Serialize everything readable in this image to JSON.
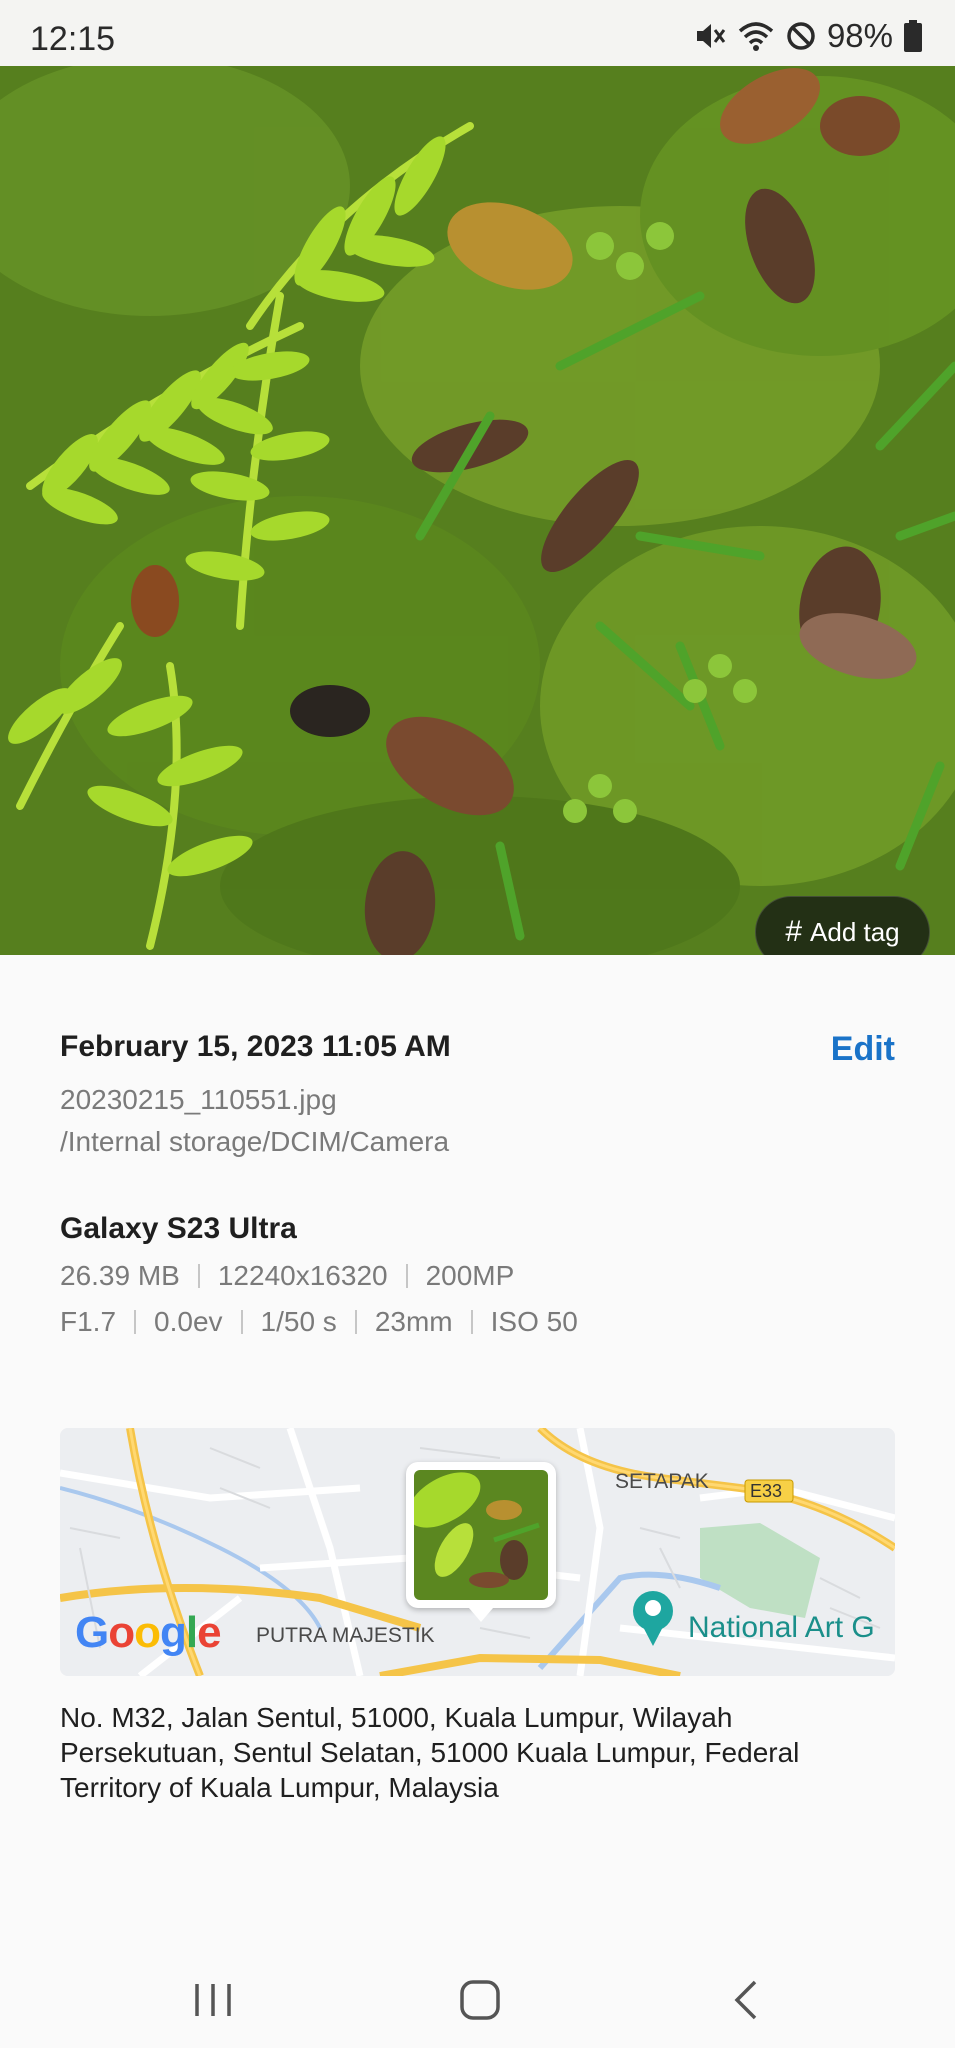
{
  "status_bar": {
    "time": "12:15",
    "battery": "98%",
    "icons": [
      "mute-icon",
      "wifi-icon",
      "do-not-disturb-icon",
      "battery-icon"
    ]
  },
  "photo": {
    "add_tag_label": "Add tag"
  },
  "details": {
    "datetime": "February 15, 2023 11:05 AM",
    "edit_label": "Edit",
    "filename": "20230215_110551.jpg",
    "path": "/Internal storage/DCIM/Camera",
    "device": "Galaxy S23 Ultra",
    "file_specs": [
      "26.39 MB",
      "12240x16320",
      "200MP"
    ],
    "camera_specs": [
      "F1.7",
      "0.0ev",
      "1/50 s",
      "23mm",
      "ISO 50"
    ]
  },
  "map": {
    "labels": {
      "setapak": "SETAPAK",
      "e33": "E33",
      "putra_majestik": "PUTRA MAJESTIK",
      "national_art": "National Art G"
    },
    "google": "Google"
  },
  "address": "No. M32, Jalan Sentul, 51000, Kuala Lumpur, Wilayah Persekutuan, Sentul Selatan, 51000 Kuala Lumpur, Federal Territory of Kuala Lumpur, Malaysia",
  "nav": {
    "icons": [
      "recent-apps-icon",
      "home-icon",
      "back-icon"
    ]
  },
  "colors": {
    "accent": "#1a73c8",
    "text_primary": "#1f1f1f",
    "text_secondary": "#7a7a7a"
  }
}
